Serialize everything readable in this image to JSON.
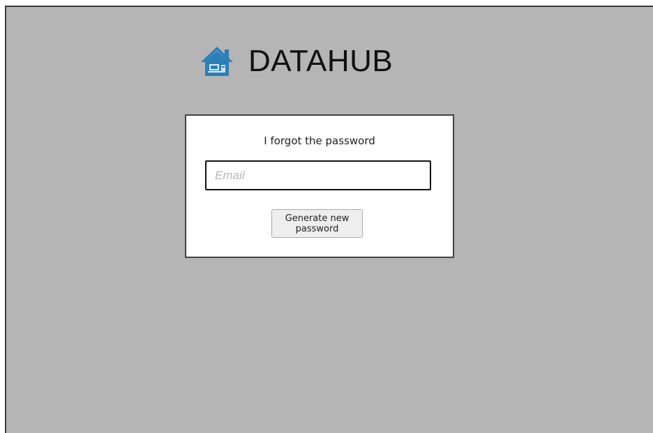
{
  "brand": {
    "title": "DATAHUB",
    "icon": "house-icon",
    "icon_color": "#2a7fb8"
  },
  "forgot_form": {
    "heading": "I forgot the password",
    "email": {
      "value": "",
      "placeholder": "Email"
    },
    "submit_label": "Generate new password"
  },
  "colors": {
    "background": "#b5b5b5",
    "panel": "#ffffff",
    "frame_border": "#3a3a3a"
  }
}
